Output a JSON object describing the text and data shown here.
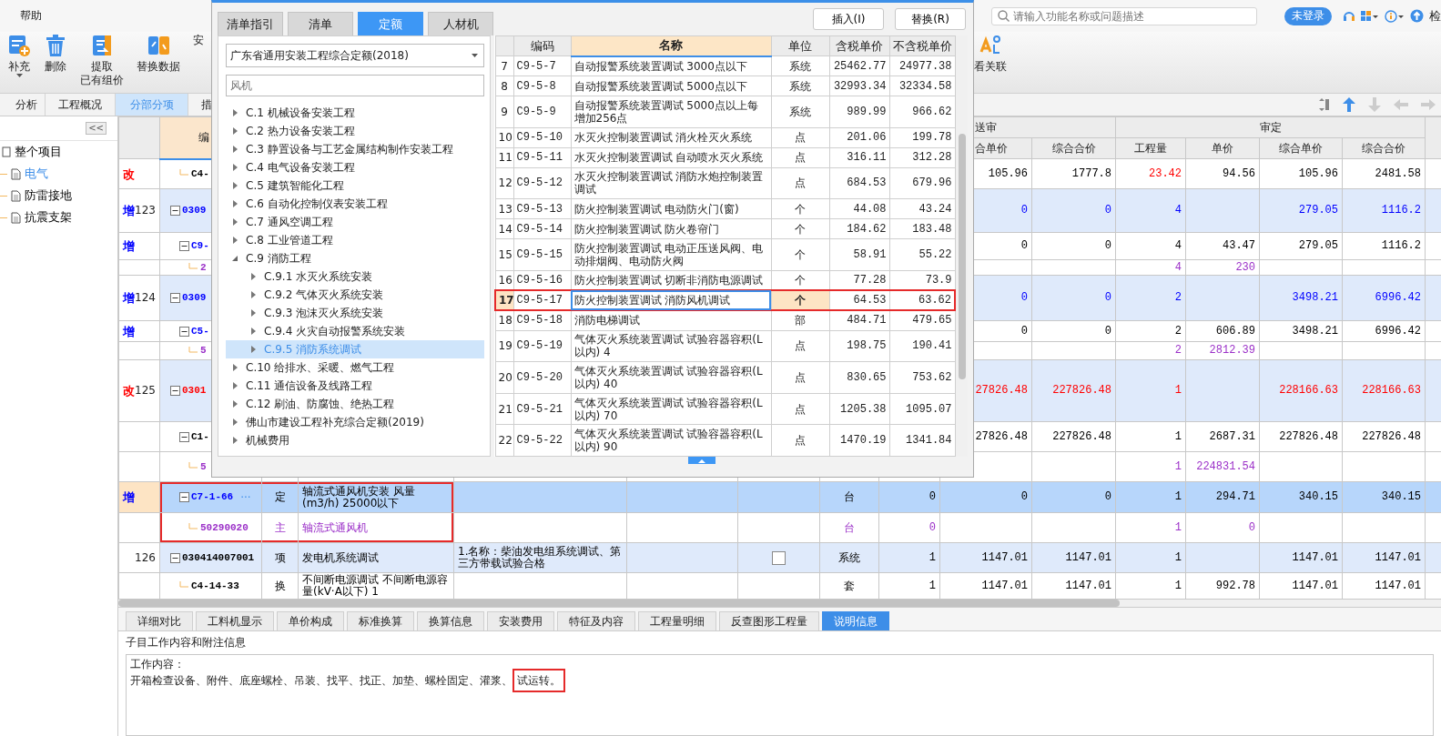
{
  "menu": [
    {
      "label": "帮助"
    }
  ],
  "search": {
    "placeholder": "请输入功能名称或问题描述"
  },
  "login_button": "未登录",
  "check_button": "检",
  "toolbar": [
    {
      "kind": "add",
      "lines": [
        "补充"
      ],
      "dropdown": true
    },
    {
      "kind": "delete",
      "lines": [
        "删除"
      ],
      "dropdown": false
    },
    {
      "kind": "extract",
      "lines": [
        "提取",
        "已有组价"
      ],
      "dropdown": false
    },
    {
      "kind": "replace",
      "lines": [
        "替换数据"
      ],
      "dropdown": false
    },
    {
      "kind": "text",
      "lines": [
        "安"
      ],
      "dropdown": false
    }
  ],
  "toolbar_right": [
    {
      "kind": "relation",
      "lines": [
        "看关联"
      ],
      "dropdown": false
    }
  ],
  "view_tabs": [
    {
      "label": "分析",
      "selected": false
    },
    {
      "label": "工程概况",
      "selected": false
    },
    {
      "label": "分部分项",
      "selected": true
    },
    {
      "label": "措",
      "selected": false
    }
  ],
  "sidebar": {
    "collapse_button": "<<",
    "items": [
      {
        "label": "整个项目",
        "selected": false,
        "children": [
          {
            "label": "电气",
            "selected": true
          },
          {
            "label": "防雷接地",
            "selected": false
          },
          {
            "label": "抗震支架",
            "selected": false
          }
        ]
      }
    ]
  },
  "grid": {
    "headers": {
      "code": "编",
      "ss_group": "送审",
      "ss_price": "合单价",
      "ss_total": "综合合价",
      "sd_group": "审定",
      "sd_qty": "工程量",
      "sd_price": "单价",
      "sd_unit": "综合单价",
      "sd_total": "综合合价"
    },
    "continued": [
      {
        "mark": {
          "text": "改",
          "color": "#ff0000"
        },
        "code": {
          "text": "C4-",
          "color": "#000000"
        },
        "color": "#000000",
        "shaded": false,
        "selected": false,
        "highlighted": false,
        "ss_price": "105.96",
        "ss_total": "1777.8",
        "sd_qty": {
          "text": "23.42",
          "color": "#ff0000"
        },
        "sd_price": "94.56",
        "sd_unit": "105.96",
        "sd_total": "2481.58"
      }
    ],
    "rows": [
      {
        "mark": {
          "text": "增",
          "color": "#0000ff"
        },
        "num": "123",
        "code": {
          "text": "0309",
          "color": "#0000ff"
        },
        "color": "#0000ff",
        "shaded": true,
        "selected": false,
        "highlighted": false,
        "ss_price": "0",
        "ss_total": "0",
        "sd_qty": "4",
        "sd_unit": "279.05",
        "sd_total": "1116.2",
        "children": [
          {
            "mark": {
              "text": "增",
              "color": "#0000ff"
            },
            "code": {
              "text": "C9-",
              "color": "#0000ff"
            },
            "color": "#000000",
            "shaded": false,
            "selected": false,
            "highlighted": false,
            "ss_price": "0",
            "ss_total": "0",
            "sd_qty": "4",
            "sd_price": "43.47",
            "sd_unit": "279.05",
            "sd_total": "1116.2",
            "children": [
              {
                "code": {
                  "text": "2",
                  "color": "#9b30c8"
                },
                "color": "#9b30c8",
                "shaded": false,
                "selected": false,
                "highlighted": false,
                "sd_qty": "4",
                "sd_price": "230"
              }
            ]
          }
        ]
      },
      {
        "mark": {
          "text": "增",
          "color": "#0000ff"
        },
        "num": "124",
        "code": {
          "text": "0309",
          "color": "#0000ff"
        },
        "color": "#0000ff",
        "shaded": true,
        "selected": false,
        "highlighted": false,
        "ss_price": "0",
        "ss_total": "0",
        "sd_qty": "2",
        "sd_unit": "3498.21",
        "sd_total": "6996.42",
        "children": [
          {
            "mark": {
              "text": "增",
              "color": "#0000ff"
            },
            "code": {
              "text": "C5-",
              "color": "#0000ff"
            },
            "color": "#000000",
            "shaded": false,
            "selected": false,
            "highlighted": false,
            "ss_price": "0",
            "ss_total": "0",
            "sd_qty": "2",
            "sd_price": "606.89",
            "sd_unit": "3498.21",
            "sd_total": "6996.42",
            "children": [
              {
                "code": {
                  "text": "5",
                  "color": "#9b30c8"
                },
                "color": "#9b30c8",
                "shaded": false,
                "selected": false,
                "highlighted": false,
                "sd_qty": "2",
                "sd_price": "2812.39"
              }
            ]
          }
        ]
      },
      {
        "mark": {
          "text": "改",
          "color": "#ff0000"
        },
        "num": "125",
        "code": {
          "text": "0301",
          "color": "#ff0000"
        },
        "color": "#ff0000",
        "shaded": true,
        "selected": false,
        "highlighted": false,
        "ss_price": "27826.48",
        "ss_total": "227826.48",
        "sd_qty": "1",
        "sd_unit": "228166.63",
        "sd_total": "228166.63",
        "children": [
          {
            "code": {
              "text": "C1-",
              "color": "#000000"
            },
            "color": "#000000",
            "shaded": false,
            "selected": false,
            "highlighted": false,
            "ss_price": "27826.48",
            "ss_total": "227826.48",
            "sd_qty": "1",
            "sd_price": "2687.31",
            "sd_unit": "227826.48",
            "sd_total": "227826.48",
            "children": [
              {
                "code": {
                  "text": "5",
                  "color": "#9b30c8"
                },
                "color": "#9b30c8",
                "shaded": false,
                "selected": false,
                "highlighted": false,
                "sd_qty": "1",
                "sd_price": "224831.54"
              }
            ]
          },
          {
            "mark": {
              "text": "增",
              "color": "#0000ff"
            },
            "code": {
              "text": "C7-1-66",
              "color": "#0000ff"
            },
            "action": "···",
            "color": "#000000",
            "shaded": false,
            "selected": true,
            "highlighted": true,
            "type": "定",
            "name": "轴流式通风机安装 风量(m3/h) 25000以下",
            "unit": "台",
            "qty": "0",
            "ss_price": "0",
            "ss_total": "0",
            "sd_qty": "1",
            "sd_price": "294.71",
            "sd_unit": "340.15",
            "sd_total": "340.15",
            "children": [
              {
                "code": {
                  "text": "50290020",
                  "color": "#9b30c8"
                },
                "color": "#9b30c8",
                "shaded": false,
                "selected": false,
                "highlighted": true,
                "type": "主",
                "name": "轴流式通风机",
                "unit": "台",
                "qty": "0",
                "sd_qty": "1",
                "sd_price": "0"
              }
            ]
          }
        ]
      },
      {
        "num": "126",
        "code": {
          "text": "030414007001",
          "color": "#000000"
        },
        "color": "#000000",
        "shaded": true,
        "selected": false,
        "highlighted": false,
        "type": "项",
        "name": "发电机系统调试",
        "feature": "1.名称：柴油发电组系统调试、第三方带载试验合格",
        "check": {
          "checked": false
        },
        "unit": "系统",
        "qty": "1",
        "ss_price": "1147.01",
        "ss_total": "1147.01",
        "sd_qty": "1",
        "sd_unit": "1147.01",
        "sd_total": "1147.01",
        "children": [
          {
            "code": {
              "text": "C4-14-33",
              "color": "#000000"
            },
            "color": "#000000",
            "shaded": false,
            "selected": false,
            "highlighted": false,
            "type": "换",
            "name": "不间断电源调试 不间断电源容量(kV·A以下) 1",
            "unit": "套",
            "qty": "1",
            "ss_price": "1147.01",
            "ss_total": "1147.01",
            "sd_qty": "1",
            "sd_price": "992.78",
            "sd_unit": "1147.01",
            "sd_total": "1147.01"
          }
        ]
      }
    ]
  },
  "dialog": {
    "tabs": [
      {
        "label": "清单指引",
        "selected": false
      },
      {
        "label": "清单",
        "selected": false
      },
      {
        "label": "定额",
        "selected": true
      },
      {
        "label": "人材机",
        "selected": false
      }
    ],
    "buttons": [
      "插入(I)",
      "替换(R)"
    ],
    "library": "广东省通用安装工程综合定额(2018)",
    "filter": {
      "placeholder": "风机"
    },
    "tree": [
      {
        "label": "C.1 机械设备安装工程",
        "expanded": false,
        "selected": false
      },
      {
        "label": "C.2 热力设备安装工程",
        "expanded": false,
        "selected": false
      },
      {
        "label": "C.3 静置设备与工艺金属结构制作安装工程",
        "expanded": false,
        "selected": false
      },
      {
        "label": "C.4 电气设备安装工程",
        "expanded": false,
        "selected": false
      },
      {
        "label": "C.5 建筑智能化工程",
        "expanded": false,
        "selected": false
      },
      {
        "label": "C.6 自动化控制仪表安装工程",
        "expanded": false,
        "selected": false
      },
      {
        "label": "C.7 通风空调工程",
        "expanded": false,
        "selected": false
      },
      {
        "label": "C.8 工业管道工程",
        "expanded": false,
        "selected": false
      },
      {
        "label": "C.9 消防工程",
        "expanded": true,
        "selected": false,
        "children": [
          {
            "label": "C.9.1 水灭火系统安装",
            "expanded": false,
            "selected": false
          },
          {
            "label": "C.9.2 气体灭火系统安装",
            "expanded": false,
            "selected": false
          },
          {
            "label": "C.9.3 泡沫灭火系统安装",
            "expanded": false,
            "selected": false
          },
          {
            "label": "C.9.4 火灾自动报警系统安装",
            "expanded": false,
            "selected": false
          },
          {
            "label": "C.9.5 消防系统调试",
            "expanded": false,
            "selected": true
          }
        ]
      },
      {
        "label": "C.10 给排水、采暖、燃气工程",
        "expanded": false,
        "selected": false
      },
      {
        "label": "C.11 通信设备及线路工程",
        "expanded": false,
        "selected": false
      },
      {
        "label": "C.12 刷油、防腐蚀、绝热工程",
        "expanded": false,
        "selected": false
      },
      {
        "label": "佛山市建设工程补充综合定额(2019)",
        "expanded": false,
        "selected": false
      },
      {
        "label": "机械费用",
        "expanded": false,
        "selected": false
      }
    ],
    "columns": [
      {
        "label": "编码",
        "selected": false
      },
      {
        "label": "名称",
        "selected": true
      },
      {
        "label": "单位",
        "selected": false
      },
      {
        "label": "含税单价",
        "selected": false
      },
      {
        "label": "不含税单价",
        "selected": false
      }
    ],
    "rows": [
      {
        "num": "7",
        "code": "C9-5-7",
        "name": "自动报警系统装置调试 3000点以下",
        "unit": "系统",
        "price_tax": "25462.77",
        "price": "24977.38",
        "selected": false,
        "highlighted": false
      },
      {
        "num": "8",
        "code": "C9-5-8",
        "name": "自动报警系统装置调试 5000点以下",
        "unit": "系统",
        "price_tax": "32993.34",
        "price": "32334.58",
        "selected": false,
        "highlighted": false
      },
      {
        "num": "9",
        "code": "C9-5-9",
        "name": "自动报警系统装置调试 5000点以上每增加256点",
        "unit": "系统",
        "price_tax": "989.99",
        "price": "966.62",
        "selected": false,
        "highlighted": false
      },
      {
        "num": "10",
        "code": "C9-5-10",
        "name": "水灭火控制装置调试 消火栓灭火系统",
        "unit": "点",
        "price_tax": "201.06",
        "price": "199.78",
        "selected": false,
        "highlighted": false
      },
      {
        "num": "11",
        "code": "C9-5-11",
        "name": "水灭火控制装置调试 自动喷水灭火系统",
        "unit": "点",
        "price_tax": "316.11",
        "price": "312.28",
        "selected": false,
        "highlighted": false
      },
      {
        "num": "12",
        "code": "C9-5-12",
        "name": "水灭火控制装置调试 消防水炮控制装置调试",
        "unit": "点",
        "price_tax": "684.53",
        "price": "679.96",
        "selected": false,
        "highlighted": false
      },
      {
        "num": "13",
        "code": "C9-5-13",
        "name": "防火控制装置调试 电动防火门(窗)",
        "unit": "个",
        "price_tax": "44.08",
        "price": "43.24",
        "selected": false,
        "highlighted": false
      },
      {
        "num": "14",
        "code": "C9-5-14",
        "name": "防火控制装置调试 防火卷帘门",
        "unit": "个",
        "price_tax": "184.62",
        "price": "183.48",
        "selected": false,
        "highlighted": false
      },
      {
        "num": "15",
        "code": "C9-5-15",
        "name": "防火控制装置调试 电动正压送风阀、电动排烟阀、电动防火阀",
        "unit": "个",
        "price_tax": "58.91",
        "price": "55.22",
        "selected": false,
        "highlighted": false
      },
      {
        "num": "16",
        "code": "C9-5-16",
        "name": "防火控制装置调试 切断非消防电源调试",
        "unit": "个",
        "price_tax": "77.28",
        "price": "73.9",
        "selected": false,
        "highlighted": false
      },
      {
        "num": "17",
        "code": "C9-5-17",
        "name": "防火控制装置调试 消防风机调试",
        "unit": "个",
        "price_tax": "64.53",
        "price": "63.62",
        "selected": true,
        "highlighted": true
      },
      {
        "num": "18",
        "code": "C9-5-18",
        "name": "消防电梯调试",
        "unit": "部",
        "price_tax": "484.71",
        "price": "479.65",
        "selected": false,
        "highlighted": false
      },
      {
        "num": "19",
        "code": "C9-5-19",
        "name": "气体灭火系统装置调试 试验容器容积(L以内) 4",
        "unit": "点",
        "price_tax": "198.75",
        "price": "190.41",
        "selected": false,
        "highlighted": false
      },
      {
        "num": "20",
        "code": "C9-5-20",
        "name": "气体灭火系统装置调试 试验容器容积(L以内) 40",
        "unit": "点",
        "price_tax": "830.65",
        "price": "753.62",
        "selected": false,
        "highlighted": false
      },
      {
        "num": "21",
        "code": "C9-5-21",
        "name": "气体灭火系统装置调试 试验容器容积(L以内) 70",
        "unit": "点",
        "price_tax": "1205.38",
        "price": "1095.07",
        "selected": false,
        "highlighted": false
      },
      {
        "num": "22",
        "code": "C9-5-22",
        "name": "气体灭火系统装置调试 试验容器容积(L以内) 90",
        "unit": "点",
        "price_tax": "1470.19",
        "price": "1341.84",
        "selected": false,
        "highlighted": false
      }
    ]
  },
  "detail_tabs": [
    {
      "label": "详细对比",
      "selected": false
    },
    {
      "label": "工料机显示",
      "selected": false
    },
    {
      "label": "单价构成",
      "selected": false
    },
    {
      "label": "标准换算",
      "selected": false
    },
    {
      "label": "换算信息",
      "selected": false
    },
    {
      "label": "安装费用",
      "selected": false
    },
    {
      "label": "特征及内容",
      "selected": false
    },
    {
      "label": "工程量明细",
      "selected": false
    },
    {
      "label": "反查图形工程量",
      "selected": false
    },
    {
      "label": "说明信息",
      "selected": true
    }
  ],
  "detail": {
    "title": "子目工作内容和附注信息",
    "heading": "工作内容：",
    "segments": [
      {
        "text": "开箱检查设备、附件、底座螺栓、吊装、找平、找正、加垫、螺栓固定、灌浆、",
        "highlighted": false
      },
      {
        "text": "试运转。",
        "highlighted": true
      }
    ]
  }
}
